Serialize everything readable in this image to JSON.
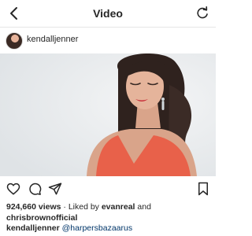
{
  "nav": {
    "title": "Video"
  },
  "post": {
    "username": "kendalljenner",
    "views": "924,660 views",
    "liked_by_prefix": " · Liked by ",
    "liked_by_user": "evanreal",
    "liked_by_and": " and",
    "liked_by_user2": "chrisbrownofficial",
    "caption_username": "kendalljenner",
    "caption_mention": "@harpersbazaarus"
  },
  "colors": {
    "text": "#262626",
    "mention": "#003569",
    "media_bg": "#eceff1",
    "dress": "#e8614a"
  },
  "icons": [
    "back-chevron-icon",
    "refresh-icon",
    "heart-icon",
    "comment-icon",
    "share-icon",
    "bookmark-icon"
  ]
}
